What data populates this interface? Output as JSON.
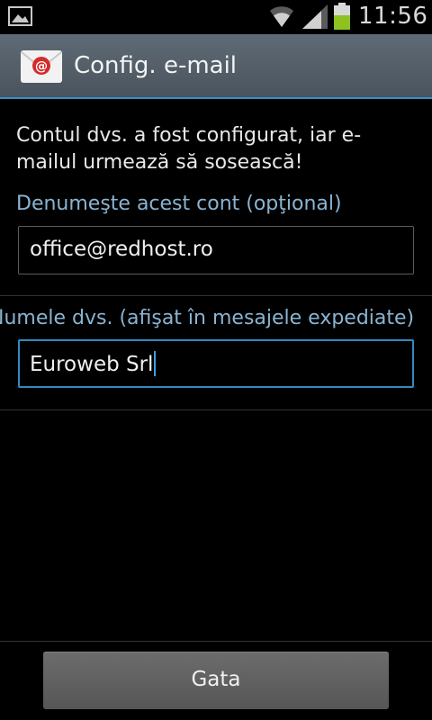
{
  "status_bar": {
    "time": "11:56",
    "icons": [
      "image-notification-icon",
      "wifi-icon",
      "signal-icon",
      "battery-icon"
    ],
    "battery_color": "#8ec21f"
  },
  "title_bar": {
    "title": "Config. e-mail",
    "icon": "email-app-icon",
    "accent_color": "#3a8fc8"
  },
  "main": {
    "message": "Contul dvs. a fost configurat, iar e-mailul urmează să sosească!",
    "account_name": {
      "label": "Denumeşte acest cont (opţional)",
      "value": "office@redhost.ro"
    },
    "sender_name": {
      "label": "Numele dvs. (afişat în mesajele expediate)",
      "value": "Euroweb Srl",
      "focused": true
    }
  },
  "footer": {
    "done_label": "Gata"
  }
}
